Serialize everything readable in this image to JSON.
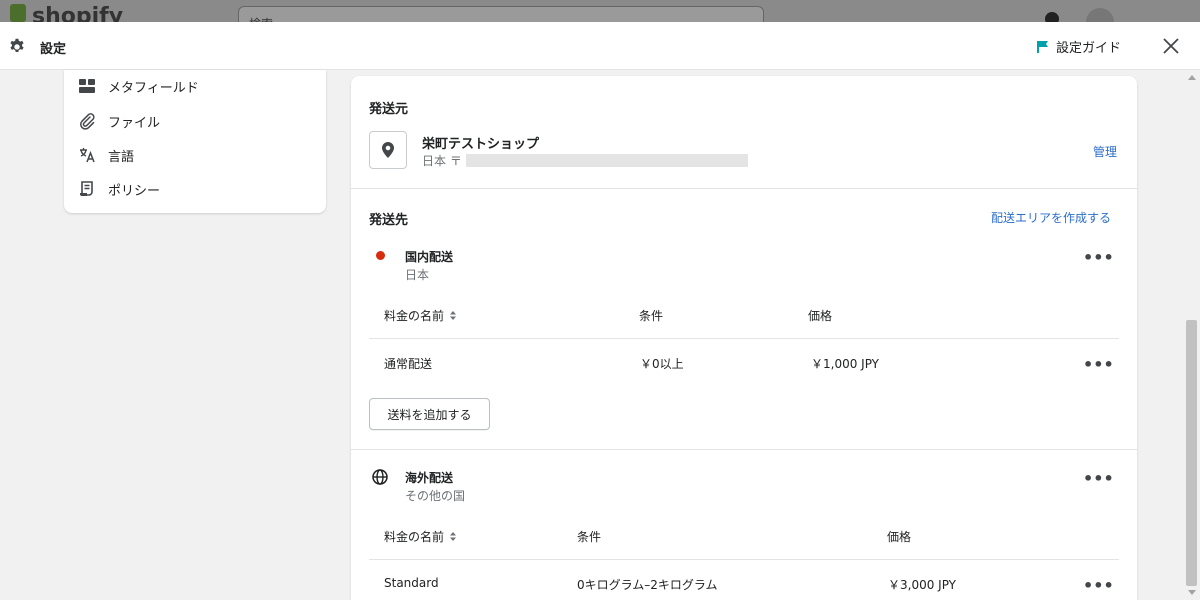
{
  "appbar": {
    "logo_text": "shopify",
    "search_placeholder": "検索"
  },
  "topbar": {
    "title": "設定",
    "guide_label": "設定ガイド"
  },
  "sidebar": {
    "items": [
      {
        "label": "メタフィールド",
        "icon": "metafields-icon"
      },
      {
        "label": "ファイル",
        "icon": "paperclip-icon"
      },
      {
        "label": "言語",
        "icon": "translate-icon"
      },
      {
        "label": "ポリシー",
        "icon": "policy-icon"
      }
    ]
  },
  "origin": {
    "title": "発送元",
    "shop_name": "栄町テストショップ",
    "address_prefix": "日本 〒",
    "manage_link": "管理"
  },
  "destination": {
    "title": "発送先",
    "create_zone_link": "配送エリアを作成する",
    "domestic": {
      "name": "国内配送",
      "region": "日本",
      "headers": {
        "rate_name": "料金の名前",
        "condition": "条件",
        "price": "価格"
      },
      "rows": [
        {
          "rate_name": "通常配送",
          "condition": "￥0以上",
          "price": "￥1,000 JPY"
        }
      ],
      "add_rate_button": "送料を追加する"
    },
    "international": {
      "name": "海外配送",
      "region": "その他の国",
      "headers": {
        "rate_name": "料金の名前",
        "condition": "条件",
        "price": "価格"
      },
      "rows": [
        {
          "rate_name": "Standard",
          "condition": "0キログラム–2キログラム",
          "price": "￥3,000 JPY"
        }
      ]
    }
  },
  "colors": {
    "accent_link": "#2c6ecb",
    "domestic_dot": "#d72c0d",
    "guide_flag": "#00a0ac"
  }
}
